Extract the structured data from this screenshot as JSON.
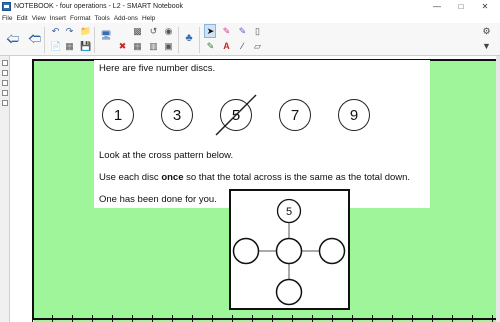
{
  "window": {
    "title": "NOTEBOOK - four operations - L2 - SMART Notebook"
  },
  "menu": [
    "File",
    "Edit",
    "View",
    "Insert",
    "Format",
    "Tools",
    "Add-ons",
    "Help"
  ],
  "colors": {
    "page_background": "#9ef59a",
    "accent": "#2f5f9e",
    "selected_tool": "#cfe3f7"
  },
  "page": {
    "line1": "Here are five number discs.",
    "discs": [
      "1",
      "3",
      "5",
      "7",
      "9"
    ],
    "crossed_disc": "5",
    "line2": "Look at the cross pattern below.",
    "line3_pre": "Use each disc ",
    "line3_bold": "once",
    "line3_post": " so that the total across is the same as the total down.",
    "line4": "One has been done for you.",
    "cross_top_value": "5"
  }
}
